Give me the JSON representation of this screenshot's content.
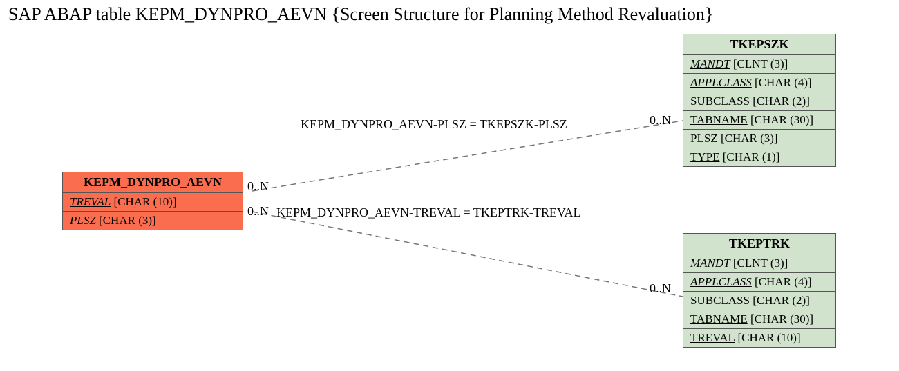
{
  "title": "SAP ABAP table KEPM_DYNPRO_AEVN {Screen Structure for Planning Method Revaluation}",
  "main_table": {
    "name": "KEPM_DYNPRO_AEVN",
    "fields": [
      {
        "name": "TREVAL",
        "type": "[CHAR (10)]",
        "italic": true
      },
      {
        "name": "PLSZ",
        "type": "[CHAR (3)]",
        "italic": true
      }
    ]
  },
  "ref_tables": [
    {
      "name": "TKEPSZK",
      "fields": [
        {
          "name": "MANDT",
          "type": "[CLNT (3)]",
          "italic": true
        },
        {
          "name": "APPLCLASS",
          "type": "[CHAR (4)]",
          "italic": true
        },
        {
          "name": "SUBCLASS",
          "type": "[CHAR (2)]",
          "italic": false
        },
        {
          "name": "TABNAME",
          "type": "[CHAR (30)]",
          "italic": false
        },
        {
          "name": "PLSZ",
          "type": "[CHAR (3)]",
          "italic": false
        },
        {
          "name": "TYPE",
          "type": "[CHAR (1)]",
          "italic": false
        }
      ]
    },
    {
      "name": "TKEPTRK",
      "fields": [
        {
          "name": "MANDT",
          "type": "[CLNT (3)]",
          "italic": true
        },
        {
          "name": "APPLCLASS",
          "type": "[CHAR (4)]",
          "italic": true
        },
        {
          "name": "SUBCLASS",
          "type": "[CHAR (2)]",
          "italic": false
        },
        {
          "name": "TABNAME",
          "type": "[CHAR (30)]",
          "italic": false
        },
        {
          "name": "TREVAL",
          "type": "[CHAR (10)]",
          "italic": false
        }
      ]
    }
  ],
  "relations": [
    {
      "label": "KEPM_DYNPRO_AEVN-PLSZ = TKEPSZK-PLSZ",
      "card_left": "0..N",
      "card_right": "0..N"
    },
    {
      "label": "KEPM_DYNPRO_AEVN-TREVAL = TKEPTRK-TREVAL",
      "card_left": "0..N",
      "card_right": "0..N"
    }
  ]
}
